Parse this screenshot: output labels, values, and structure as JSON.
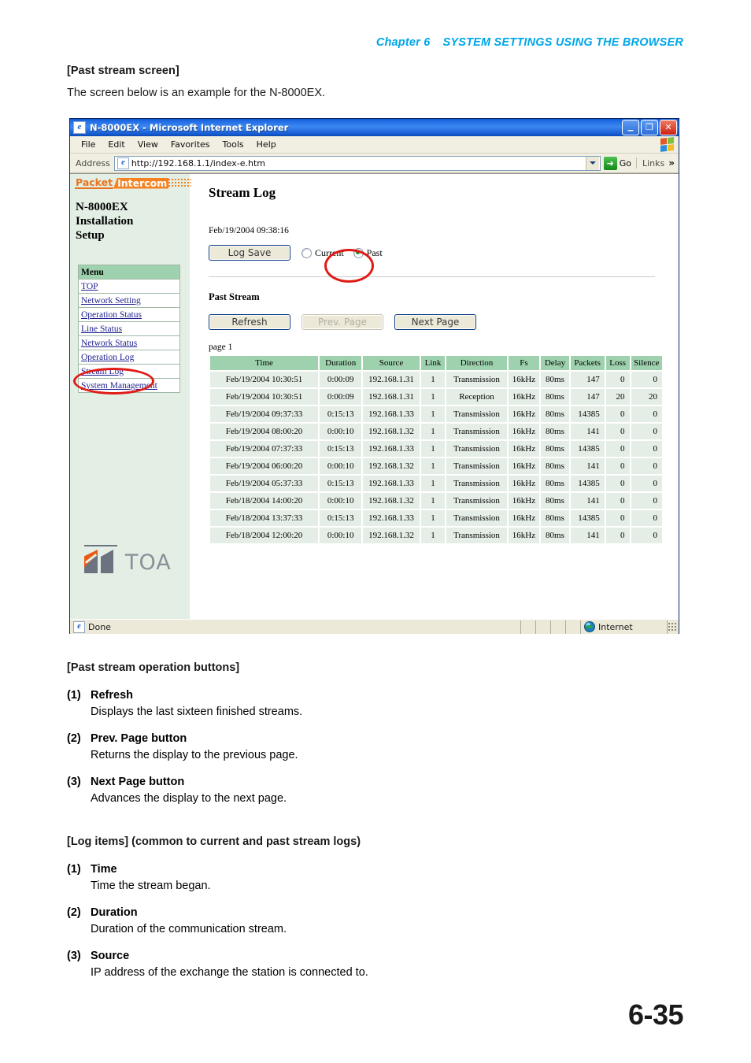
{
  "document": {
    "chapter_label": "Chapter 6",
    "chapter_title": "SYSTEM SETTINGS USING THE BROWSER",
    "section_heading": "[Past stream screen]",
    "section_intro": "The screen below is an example for the N-8000EX.",
    "page_number": "6-35",
    "accent_color": "#00a6e8"
  },
  "browser": {
    "title": "N-8000EX - Microsoft Internet Explorer",
    "window_buttons": {
      "minimize": "_",
      "maximize": "❐",
      "close": "✕"
    },
    "menus": [
      "File",
      "Edit",
      "View",
      "Favorites",
      "Tools",
      "Help"
    ],
    "address_label": "Address",
    "address_value": "http://192.168.1.1/index-e.htm",
    "go_label": "Go",
    "links_label": "Links",
    "links_chevron": "»",
    "status": {
      "text": "Done",
      "zone": "Internet"
    }
  },
  "sidebar": {
    "logo": {
      "word1": "Packet",
      "word2": "Intercom"
    },
    "title_lines": [
      "N-8000EX",
      "Installation",
      "Setup"
    ],
    "menu_header": "Menu",
    "items": [
      {
        "label": "TOP"
      },
      {
        "label": "Network Setting"
      },
      {
        "label": "Operation Status"
      },
      {
        "label": "Line Status"
      },
      {
        "label": "Network Status"
      },
      {
        "label": "Operation Log"
      },
      {
        "label": "Stream Log"
      },
      {
        "label": "System Management"
      }
    ],
    "brand": "TOA"
  },
  "main": {
    "heading": "Stream Log",
    "timestamp": "Feb/19/2004 09:38:16",
    "log_save_label": "Log Save",
    "radios": [
      {
        "label": "Current",
        "selected": false
      },
      {
        "label": "Past",
        "selected": true
      }
    ],
    "past_stream_heading": "Past Stream",
    "buttons": [
      {
        "label": "Refresh",
        "disabled": false
      },
      {
        "label": "Prev. Page",
        "disabled": true
      },
      {
        "label": "Next Page",
        "disabled": false
      }
    ],
    "page_label": "page 1",
    "table": {
      "columns": [
        "Time",
        "Duration",
        "Source",
        "Link",
        "Direction",
        "Fs",
        "Delay",
        "Packets",
        "Loss",
        "Silence"
      ],
      "rows": [
        [
          "Feb/19/2004 10:30:51",
          "0:00:09",
          "192.168.1.31",
          "1",
          "Transmission",
          "16kHz",
          "80ms",
          "147",
          "0",
          "0"
        ],
        [
          "Feb/19/2004 10:30:51",
          "0:00:09",
          "192.168.1.31",
          "1",
          "Reception",
          "16kHz",
          "80ms",
          "147",
          "20",
          "20"
        ],
        [
          "Feb/19/2004 09:37:33",
          "0:15:13",
          "192.168.1.33",
          "1",
          "Transmission",
          "16kHz",
          "80ms",
          "14385",
          "0",
          "0"
        ],
        [
          "Feb/19/2004 08:00:20",
          "0:00:10",
          "192.168.1.32",
          "1",
          "Transmission",
          "16kHz",
          "80ms",
          "141",
          "0",
          "0"
        ],
        [
          "Feb/19/2004 07:37:33",
          "0:15:13",
          "192.168.1.33",
          "1",
          "Transmission",
          "16kHz",
          "80ms",
          "14385",
          "0",
          "0"
        ],
        [
          "Feb/19/2004 06:00:20",
          "0:00:10",
          "192.168.1.32",
          "1",
          "Transmission",
          "16kHz",
          "80ms",
          "141",
          "0",
          "0"
        ],
        [
          "Feb/19/2004 05:37:33",
          "0:15:13",
          "192.168.1.33",
          "1",
          "Transmission",
          "16kHz",
          "80ms",
          "14385",
          "0",
          "0"
        ],
        [
          "Feb/18/2004 14:00:20",
          "0:00:10",
          "192.168.1.32",
          "1",
          "Transmission",
          "16kHz",
          "80ms",
          "141",
          "0",
          "0"
        ],
        [
          "Feb/18/2004 13:37:33",
          "0:15:13",
          "192.168.1.33",
          "1",
          "Transmission",
          "16kHz",
          "80ms",
          "14385",
          "0",
          "0"
        ],
        [
          "Feb/18/2004 12:00:20",
          "0:00:10",
          "192.168.1.32",
          "1",
          "Transmission",
          "16kHz",
          "80ms",
          "141",
          "0",
          "0"
        ]
      ]
    }
  },
  "notes": {
    "buttons_heading": "[Past stream operation buttons]",
    "buttons_items": [
      {
        "n": "(1)",
        "term": "Refresh",
        "desc": "Displays the last sixteen finished streams."
      },
      {
        "n": "(2)",
        "term": "Prev. Page button",
        "desc": "Returns the display to the previous page."
      },
      {
        "n": "(3)",
        "term": "Next Page button",
        "desc": "Advances the display to the next page."
      }
    ],
    "log_heading_bold": "[Log items]",
    "log_heading_rest": " (common to current and past stream logs)",
    "log_items": [
      {
        "n": "(1)",
        "term": "Time",
        "desc": "Time the stream began."
      },
      {
        "n": "(2)",
        "term": "Duration",
        "desc": "Duration of the communication stream."
      },
      {
        "n": "(3)",
        "term": "Source",
        "desc": "IP address of the exchange the station is connected to."
      }
    ]
  },
  "annotations": {
    "past_radio_circle": "red-ellipse-around-past-radio",
    "stream_log_circle": "red-ellipse-around-stream-log-link"
  }
}
